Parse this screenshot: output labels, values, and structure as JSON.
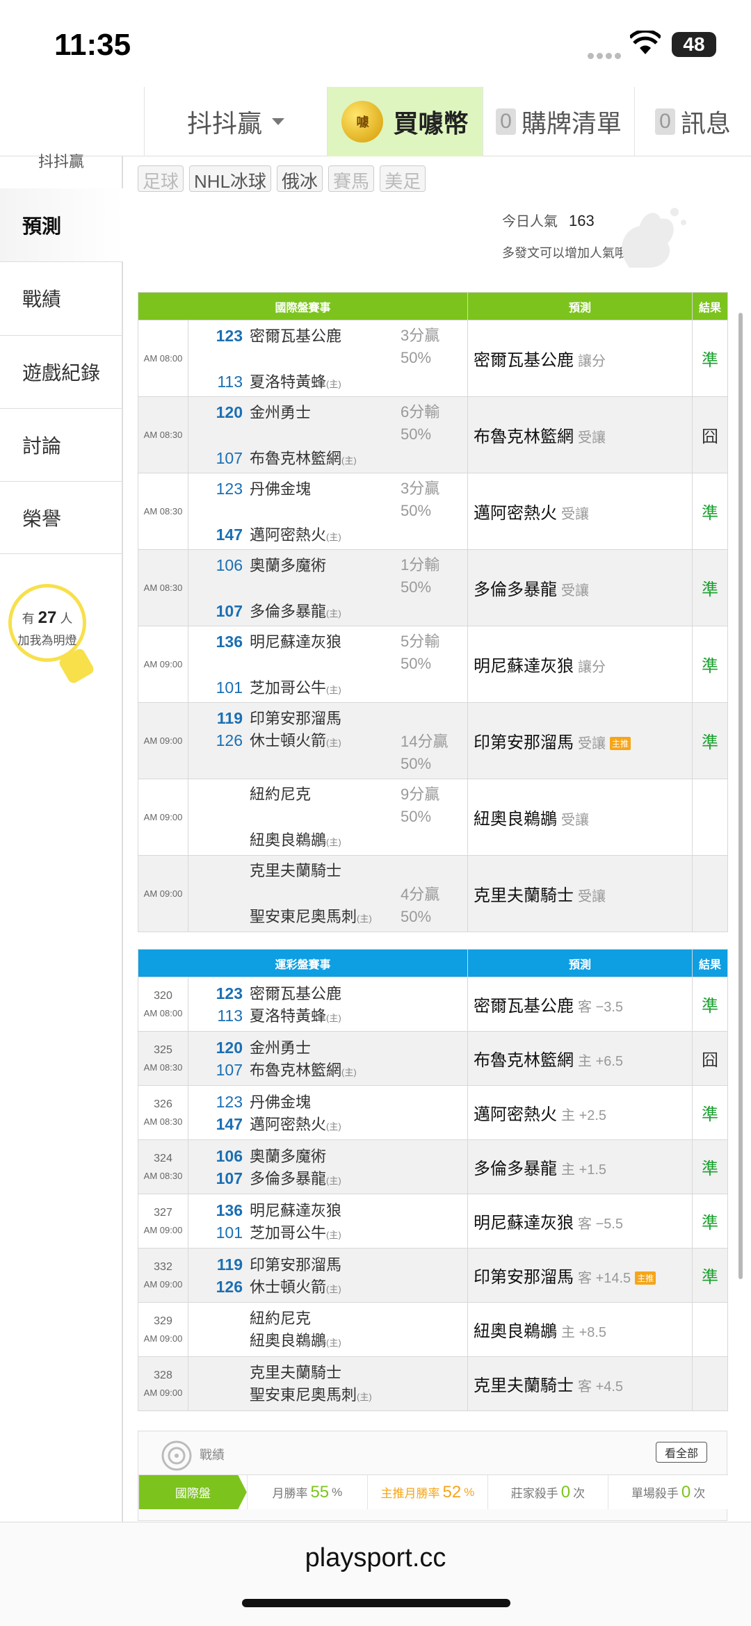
{
  "status": {
    "time": "11:35",
    "battery": "48"
  },
  "nav": {
    "app": "抖抖贏",
    "buy": "買噱幣",
    "buy_icon_text": "噱",
    "cart_count": "0",
    "cart": "購牌清單",
    "msg_count": "0",
    "msg": "訊息"
  },
  "side": {
    "partial": "抖抖贏",
    "items": [
      "預測",
      "戰績",
      "遊戲紀錄",
      "討論",
      "榮譽"
    ],
    "bulb_pre": "有",
    "bulb_num": "27",
    "bulb_post": "人",
    "bulb_line2": "加我為明燈"
  },
  "filters": [
    "足球",
    "NHL冰球",
    "俄冰",
    "賽馬",
    "美足"
  ],
  "popularity": {
    "label": "今日人氣",
    "value": "163",
    "hint": "多發文可以增加人氣哦～"
  },
  "intl": {
    "header": [
      "國際盤賽事",
      "預測",
      "結果"
    ],
    "rows": [
      {
        "time": "AM 08:00",
        "n1": "123",
        "t1": "密爾瓦基公鹿",
        "n2": "113",
        "t2": "夏洛特黃蜂",
        "home": "(主)",
        "s1": "3分贏",
        "s2": "50%",
        "pred": "密爾瓦基公鹿",
        "sub": "讓分",
        "res": "準"
      },
      {
        "time": "AM 08:30",
        "n1": "120",
        "t1": "金州勇士",
        "n2": "107",
        "t2": "布魯克林籃網",
        "home": "(主)",
        "s1": "6分輸",
        "s2": "50%",
        "pred": "布魯克林籃網",
        "sub": "受讓",
        "res": "囧"
      },
      {
        "time": "AM 08:30",
        "n1": "123",
        "t1": "丹佛金塊",
        "n2": "147",
        "t2": "邁阿密熱火",
        "home": "(主)",
        "s1": "3分贏",
        "s2": "50%",
        "pred": "邁阿密熱火",
        "sub": "受讓",
        "res": "準"
      },
      {
        "time": "AM 08:30",
        "n1": "106",
        "t1": "奧蘭多魔術",
        "n2": "107",
        "t2": "多倫多暴龍",
        "home": "(主)",
        "s1": "1分輸",
        "s2": "50%",
        "pred": "多倫多暴龍",
        "sub": "受讓",
        "res": "準"
      },
      {
        "time": "AM 09:00",
        "n1": "136",
        "t1": "明尼蘇達灰狼",
        "n2": "101",
        "t2": "芝加哥公牛",
        "home": "(主)",
        "s1": "5分輸",
        "s2": "50%",
        "pred": "明尼蘇達灰狼",
        "sub": "讓分",
        "res": "準"
      },
      {
        "time": "AM 09:00",
        "n1": "119",
        "t1": "印第安那溜馬",
        "n2": "126",
        "t2": "休士頓火箭",
        "home": "(主)",
        "s1": "14分贏",
        "s2": "50%",
        "pred": "印第安那溜馬",
        "sub": "受讓",
        "tag": "主推",
        "res": "準"
      },
      {
        "time": "AM 09:00",
        "n1": "",
        "t1": "紐約尼克",
        "n2": "",
        "t2": "紐奧良鵜鶘",
        "home": "(主)",
        "s1": "9分贏",
        "s2": "50%",
        "pred": "紐奧良鵜鶘",
        "sub": "受讓",
        "res": ""
      },
      {
        "time": "AM 09:00",
        "n1": "",
        "t1": "克里夫蘭騎士",
        "n2": "",
        "t2": "聖安東尼奧馬刺",
        "home": "(主)",
        "s1": "4分贏",
        "s2": "50%",
        "pred": "克里夫蘭騎士",
        "sub": "受讓",
        "res": ""
      }
    ]
  },
  "lottery": {
    "header": [
      "運彩盤賽事",
      "預測",
      "結果"
    ],
    "rows": [
      {
        "code": "320",
        "time": "AM 08:00",
        "n1": "123",
        "t1": "密爾瓦基公鹿",
        "n2": "113",
        "t2": "夏洛特黃蜂",
        "home": "(主)",
        "pred": "密爾瓦基公鹿",
        "sub": "客 −3.5",
        "res": "準"
      },
      {
        "code": "325",
        "time": "AM 08:30",
        "n1": "120",
        "t1": "金州勇士",
        "n2": "107",
        "t2": "布魯克林籃網",
        "home": "(主)",
        "pred": "布魯克林籃網",
        "sub": "主 +6.5",
        "res": "囧"
      },
      {
        "code": "326",
        "time": "AM 08:30",
        "n1": "123",
        "t1": "丹佛金塊",
        "n2": "147",
        "t2": "邁阿密熱火",
        "home": "(主)",
        "pred": "邁阿密熱火",
        "sub": "主 +2.5",
        "res": "準"
      },
      {
        "code": "324",
        "time": "AM 08:30",
        "n1": "106",
        "t1": "奧蘭多魔術",
        "n2": "107",
        "t2": "多倫多暴龍",
        "home": "(主)",
        "pred": "多倫多暴龍",
        "sub": "主 +1.5",
        "res": "準"
      },
      {
        "code": "327",
        "time": "AM 09:00",
        "n1": "136",
        "t1": "明尼蘇達灰狼",
        "n2": "101",
        "t2": "芝加哥公牛",
        "home": "(主)",
        "pred": "明尼蘇達灰狼",
        "sub": "客 −5.5",
        "res": "準"
      },
      {
        "code": "332",
        "time": "AM 09:00",
        "n1": "119",
        "t1": "印第安那溜馬",
        "n2": "126",
        "t2": "休士頓火箭",
        "home": "(主)",
        "pred": "印第安那溜馬",
        "sub": "客 +14.5",
        "tag": "主推",
        "res": "準"
      },
      {
        "code": "329",
        "time": "AM 09:00",
        "n1": "",
        "t1": "紐約尼克",
        "n2": "",
        "t2": "紐奧良鵜鶘",
        "home": "(主)",
        "pred": "紐奧良鵜鶘",
        "sub": "主 +8.5",
        "res": ""
      },
      {
        "code": "328",
        "time": "AM 09:00",
        "n1": "",
        "t1": "克里夫蘭騎士",
        "n2": "",
        "t2": "聖安東尼奧馬刺",
        "home": "(主)",
        "pred": "克里夫蘭騎士",
        "sub": "客 +4.5",
        "res": ""
      }
    ]
  },
  "record": {
    "title": "戰績",
    "view_all": "看全部",
    "intl": "國際盤",
    "month_win": "月勝率",
    "month_val": "55",
    "pct": "%",
    "main_month": "主推月勝率",
    "main_val": "52",
    "banker": "莊家殺手",
    "banker_val": "0",
    "times": "次",
    "single": "單場殺手",
    "single_val": "0"
  },
  "url": "playsport.cc"
}
